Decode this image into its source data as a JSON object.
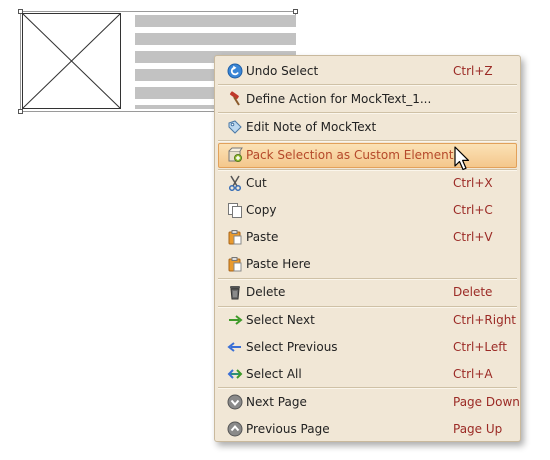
{
  "canvas": {
    "image_widget": "image-placeholder",
    "text_widget": "MockText"
  },
  "context_menu": {
    "items": [
      {
        "label": "Undo Select",
        "shortcut": "Ctrl+Z",
        "icon": "undo-icon"
      },
      {
        "label": "Define Action for MockText_1...",
        "shortcut": "",
        "icon": "hammer-icon"
      },
      {
        "label": "Edit Note of MockText",
        "shortcut": "",
        "icon": "note-tag-icon"
      },
      {
        "label": "Pack Selection as Custom Element...",
        "shortcut": "",
        "icon": "package-icon",
        "highlighted": true
      },
      {
        "label": "Cut",
        "shortcut": "Ctrl+X",
        "icon": "scissors-icon"
      },
      {
        "label": "Copy",
        "shortcut": "Ctrl+C",
        "icon": "copy-icon"
      },
      {
        "label": "Paste",
        "shortcut": "Ctrl+V",
        "icon": "clipboard-icon"
      },
      {
        "label": "Paste Here",
        "shortcut": "",
        "icon": "clipboard-here-icon"
      },
      {
        "label": "Delete",
        "shortcut": "Delete",
        "icon": "trash-icon"
      },
      {
        "label": "Select Next",
        "shortcut": "Ctrl+Right",
        "icon": "arrow-right-icon"
      },
      {
        "label": "Select Previous",
        "shortcut": "Ctrl+Left",
        "icon": "arrow-left-icon"
      },
      {
        "label": "Select All",
        "shortcut": "Ctrl+A",
        "icon": "arrow-both-icon"
      },
      {
        "label": "Next Page",
        "shortcut": "Page Down",
        "icon": "page-down-icon"
      },
      {
        "label": "Previous Page",
        "shortcut": "Page Up",
        "icon": "page-up-icon"
      }
    ]
  },
  "colors": {
    "menu_background": "#f1e7d6",
    "shortcut_text": "#9b2a25",
    "highlight_text": "#b5492a",
    "highlight_fill": "#f4c78c"
  }
}
